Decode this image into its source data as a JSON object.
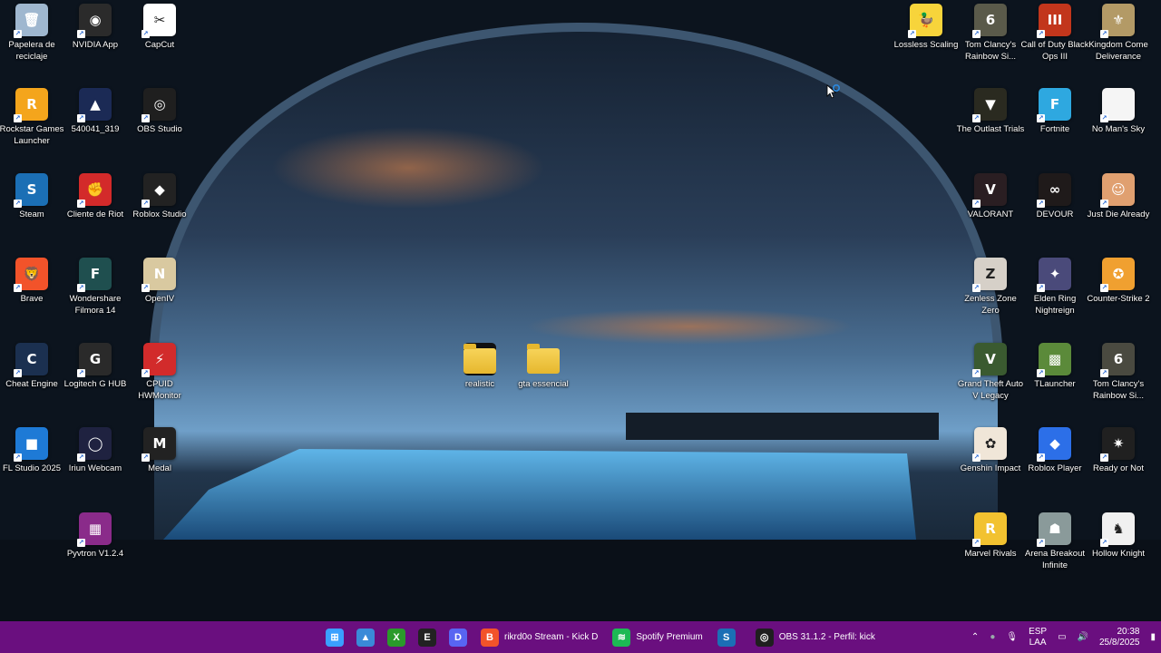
{
  "desktop": {
    "left_icons": [
      {
        "label": "Papelera de reciclaje",
        "icon": "recycle-bin-icon",
        "color": "#9fb7cf",
        "glyph": "🗑"
      },
      {
        "label": "NVIDIA App",
        "icon": "nvidia-icon",
        "color": "#2b2b2b",
        "glyph": "◉"
      },
      {
        "label": "CapCut",
        "icon": "capcut-icon",
        "color": "#ffffff",
        "glyph": "✂"
      },
      {
        "label": "Rockstar Games Launcher",
        "icon": "rockstar-icon",
        "color": "#f4a51c",
        "glyph": "R"
      },
      {
        "label": "540041_319",
        "icon": "image-file-icon",
        "color": "#1b2a55",
        "glyph": "▲"
      },
      {
        "label": "OBS Studio",
        "icon": "obs-icon",
        "color": "#1f1f1f",
        "glyph": "◎"
      },
      {
        "label": "Steam",
        "icon": "steam-icon",
        "color": "#1b6fb5",
        "glyph": "S"
      },
      {
        "label": "Cliente de Riot",
        "icon": "riot-icon",
        "color": "#d32a2a",
        "glyph": "✊"
      },
      {
        "label": "Roblox Studio",
        "icon": "roblox-studio-icon",
        "color": "#222222",
        "glyph": "◆"
      },
      {
        "label": "Brave",
        "icon": "brave-icon",
        "color": "#f2532a",
        "glyph": "🦁"
      },
      {
        "label": "Wondershare Filmora 14",
        "icon": "filmora-icon",
        "color": "#1f4f4f",
        "glyph": "F"
      },
      {
        "label": "OpenIV",
        "icon": "openiv-icon",
        "color": "#d9c9a0",
        "glyph": "N"
      },
      {
        "label": "Cheat Engine",
        "icon": "cheat-engine-icon",
        "color": "#1b3050",
        "glyph": "C"
      },
      {
        "label": "Logitech G HUB",
        "icon": "logitech-icon",
        "color": "#2a2a2a",
        "glyph": "G"
      },
      {
        "label": "CPUID HWMonitor",
        "icon": "hwmonitor-icon",
        "color": "#d22b2b",
        "glyph": "⚡"
      },
      {
        "label": "FL Studio 2025",
        "icon": "fl-studio-icon",
        "color": "#1e7ad6",
        "glyph": "■"
      },
      {
        "label": "Iriun Webcam",
        "icon": "iriun-icon",
        "color": "#1f2240",
        "glyph": "◯"
      },
      {
        "label": "Medal",
        "icon": "medal-icon",
        "color": "#222222",
        "glyph": "M"
      },
      {
        "label": "Pyvtron V1.2.4",
        "icon": "winrar-icon",
        "color": "#8a2b8a",
        "glyph": "▦"
      }
    ],
    "right_icons": [
      {
        "label": "Lossless Scaling",
        "icon": "duck-icon",
        "color": "#f7d43b",
        "glyph": "🦆"
      },
      {
        "label": "Tom Clancy's Rainbow Si...",
        "icon": "rainbow-six-icon",
        "color": "#5a5a4a",
        "glyph": "6"
      },
      {
        "label": "Call of Duty Black Ops III",
        "icon": "cod-icon",
        "color": "#c2361c",
        "glyph": "III"
      },
      {
        "label": "Kingdom Come Deliverance",
        "icon": "kcd-icon",
        "color": "#b39a66",
        "glyph": "⚜"
      },
      {
        "label": "The Outlast Trials",
        "icon": "outlast-icon",
        "color": "#2a2a20",
        "glyph": "▼"
      },
      {
        "label": "Fortnite",
        "icon": "fortnite-icon",
        "color": "#2ea8e0",
        "glyph": "F"
      },
      {
        "label": "No Man's Sky",
        "icon": "blank-file-icon",
        "color": "#f5f5f5",
        "glyph": ""
      },
      {
        "label": "VALORANT",
        "icon": "valorant-icon",
        "color": "#2a1e22",
        "glyph": "V"
      },
      {
        "label": "DEVOUR",
        "icon": "devour-icon",
        "color": "#1f1a1a",
        "glyph": "∞"
      },
      {
        "label": "Just Die Already",
        "icon": "just-die-icon",
        "color": "#e0a070",
        "glyph": "☺"
      },
      {
        "label": "Zenless Zone Zero",
        "icon": "zzz-icon",
        "color": "#d6d0c8",
        "glyph": "Z"
      },
      {
        "label": "Elden Ring Nightreign",
        "icon": "elden-ring-icon",
        "color": "#4a4a7a",
        "glyph": "✦"
      },
      {
        "label": "Counter-Strike 2",
        "icon": "cs2-icon",
        "color": "#f0a030",
        "glyph": "✪"
      },
      {
        "label": "Grand Theft Auto V Legacy",
        "icon": "gta-icon",
        "color": "#3a5a30",
        "glyph": "V"
      },
      {
        "label": "TLauncher",
        "icon": "tlauncher-icon",
        "color": "#5b8a3a",
        "glyph": "▩"
      },
      {
        "label": "Tom Clancy's Rainbow Si...",
        "icon": "rainbow-six-icon",
        "color": "#4a4a40",
        "glyph": "6"
      },
      {
        "label": "Genshin Impact",
        "icon": "genshin-icon",
        "color": "#f0e6d8",
        "glyph": "✿"
      },
      {
        "label": "Roblox Player",
        "icon": "roblox-icon",
        "color": "#2c6fe8",
        "glyph": "◆"
      },
      {
        "label": "Ready or Not",
        "icon": "ready-or-not-icon",
        "color": "#202020",
        "glyph": "✷"
      },
      {
        "label": "Marvel Rivals",
        "icon": "marvel-rivals-icon",
        "color": "#f2c230",
        "glyph": "R"
      },
      {
        "label": "Arena Breakout Infinite",
        "icon": "arena-breakout-icon",
        "color": "#8a9a9a",
        "glyph": "☗"
      },
      {
        "label": "Hollow Knight",
        "icon": "hollow-knight-icon",
        "color": "#f0f0f0",
        "glyph": "♞"
      }
    ],
    "folders": [
      {
        "label": "realistic"
      },
      {
        "label": "gta essencial"
      }
    ]
  },
  "taskbar": {
    "pinned": [
      {
        "name": "start-icon",
        "color": "#3aa0ff",
        "glyph": "⊞"
      },
      {
        "name": "photos-icon",
        "color": "#3a8ad8",
        "glyph": "▲"
      },
      {
        "name": "xbox-icon",
        "color": "#2a9a2a",
        "glyph": "X"
      },
      {
        "name": "epic-games-icon",
        "color": "#222222",
        "glyph": "E"
      },
      {
        "name": "discord-icon",
        "color": "#5865f2",
        "glyph": "D"
      }
    ],
    "apps": [
      {
        "name": "brave-taskbar",
        "icon": "brave-icon",
        "color": "#f2532a",
        "glyph": "B",
        "label": "rikrd0o Stream - Kick D"
      },
      {
        "name": "spotify-taskbar",
        "icon": "spotify-icon",
        "color": "#1db954",
        "glyph": "≋",
        "label": "Spotify Premium"
      },
      {
        "name": "steam-taskbar",
        "icon": "steam-icon",
        "color": "#1b6fb5",
        "glyph": "S",
        "label": ""
      },
      {
        "name": "obs-taskbar",
        "icon": "obs-icon",
        "color": "#1f1f1f",
        "glyph": "◎",
        "label": "OBS 31.1.2 - Perfil: kick"
      }
    ],
    "tray": {
      "lang_top": "ESP",
      "lang_bottom": "LAA",
      "time": "20:38",
      "date": "25/8/2025"
    }
  }
}
